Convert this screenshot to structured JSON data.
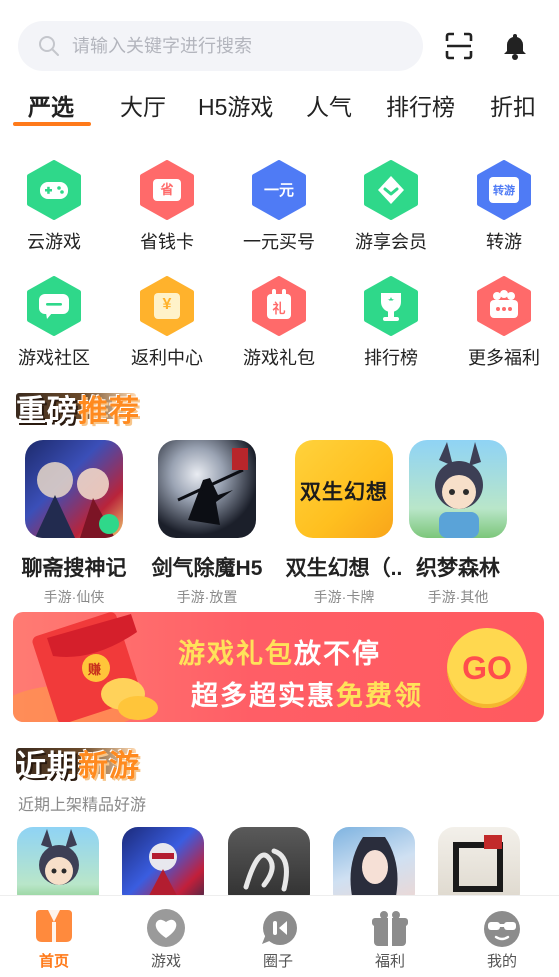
{
  "search": {
    "placeholder": "请输入关键字进行搜索"
  },
  "tabs": [
    {
      "label": "严选",
      "active": true
    },
    {
      "label": "大厅"
    },
    {
      "label": "H5游戏"
    },
    {
      "label": "人气"
    },
    {
      "label": "排行榜"
    },
    {
      "label": "折扣"
    }
  ],
  "features": [
    {
      "label": "云游戏",
      "icon": "gamepad-icon",
      "color": "#2fd88a"
    },
    {
      "label": "省钱卡",
      "icon": "save-card-icon",
      "color": "#ff6a6a",
      "glyph": "省"
    },
    {
      "label": "一元买号",
      "icon": "one-yuan-icon",
      "color": "#4f7bf5",
      "glyph": "一元"
    },
    {
      "label": "游享会员",
      "icon": "vip-icon",
      "color": "#2fd88a"
    },
    {
      "label": "转游",
      "icon": "transfer-game-icon",
      "color": "#4f7bf5",
      "glyph": "转游"
    },
    {
      "label": "游戏社区",
      "icon": "chat-icon",
      "color": "#2fd88a"
    },
    {
      "label": "返利中心",
      "icon": "rebate-icon",
      "color": "#ffb22c",
      "glyph": "¥"
    },
    {
      "label": "游戏礼包",
      "icon": "gift-icon",
      "color": "#ff6a6a",
      "glyph": "礼"
    },
    {
      "label": "排行榜",
      "icon": "trophy-icon",
      "color": "#2fd88a"
    },
    {
      "label": "更多福利",
      "icon": "more-benefits-icon",
      "color": "#ff6a6a"
    }
  ],
  "section_featured": {
    "part1": "重磅",
    "part2": "推荐"
  },
  "featured_games": [
    {
      "name": "聊斋搜神记",
      "tag": "手游·仙侠"
    },
    {
      "name": "剑气除魔H5",
      "tag": "手游·放置"
    },
    {
      "name": "双生幻想（..",
      "tag": "手游·卡牌",
      "art_text": "双生幻想"
    },
    {
      "name": "织梦森林",
      "tag": "手游·其他"
    }
  ],
  "banner": {
    "line1_a": "游戏礼包",
    "line1_b": "放不停",
    "line2_a": "超多超实惠",
    "line2_b": "免费领",
    "go": "GO",
    "envelope_glyph": "赚"
  },
  "section_new": {
    "part1": "近期",
    "part2": "新游",
    "subtitle": "近期上架精品好游"
  },
  "new_games_count": 5,
  "nav": [
    {
      "label": "首页",
      "active": true
    },
    {
      "label": "游戏"
    },
    {
      "label": "圈子"
    },
    {
      "label": "福利"
    },
    {
      "label": "我的"
    }
  ],
  "colors": {
    "accent": "#ff7a1a",
    "green": "#2fd88a",
    "blue": "#4f7bf5",
    "red": "#ff6a6a",
    "yellow": "#ffb22c"
  }
}
